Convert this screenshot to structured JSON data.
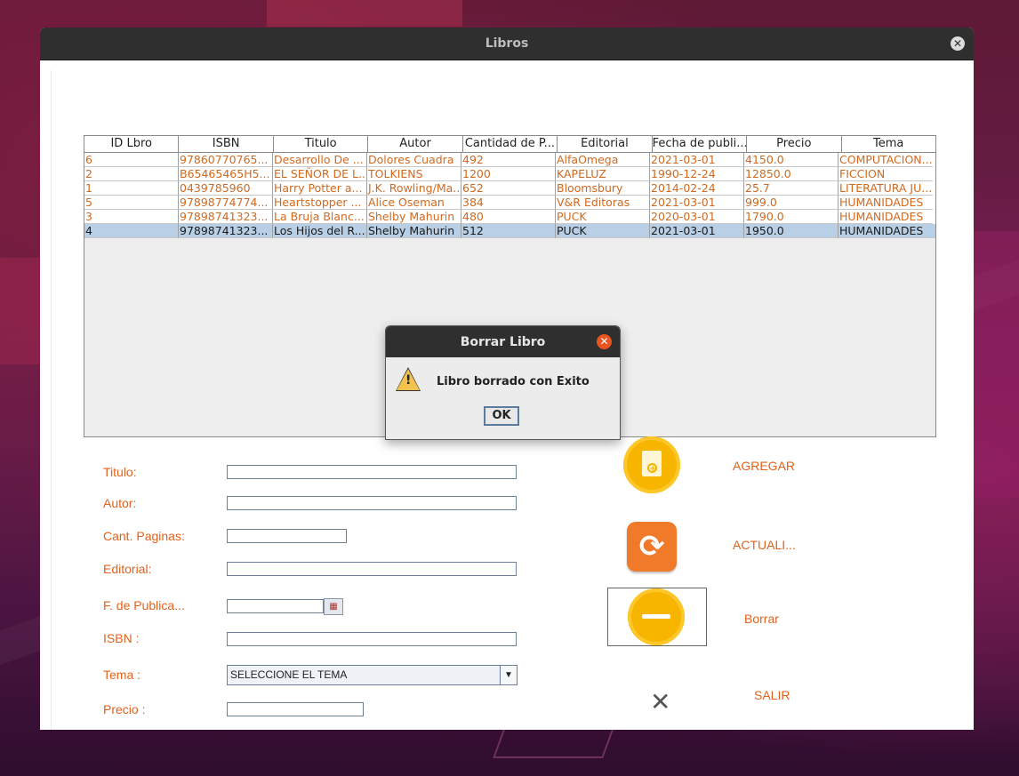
{
  "window": {
    "title": "Libros"
  },
  "table": {
    "headers": [
      "ID Lbro",
      "ISBN",
      "Titulo",
      "Autor",
      "Cantidad de P...",
      "Editorial",
      "Fecha de publi...",
      "Precio",
      "Tema"
    ],
    "rows": [
      [
        "6",
        "97860770765...",
        "Desarrollo De ...",
        "Dolores Cuadra",
        "492",
        "AlfaOmega",
        "2021-03-01",
        "4150.0",
        "COMPUTACION..."
      ],
      [
        "2",
        "B65465465H5...",
        "EL SEÑOR DE L...",
        "TOLKIENS",
        "1200",
        "KAPELUZ",
        "1990-12-24",
        "12850.0",
        "FICCION"
      ],
      [
        "1",
        "0439785960",
        "Harry Potter a...",
        "J.K. Rowling/Ma...",
        "652",
        "Bloomsbury",
        "2014-02-24",
        "25.7",
        "LITERATURA JU..."
      ],
      [
        "5",
        "97898774774...",
        "Heartstopper ...",
        "Alice Oseman",
        "384",
        "V&R Editoras",
        "2021-03-01",
        "999.0",
        "HUMANIDADES"
      ],
      [
        "3",
        "97898741323...",
        "La Bruja Blanc...",
        "Shelby Mahurin",
        "480",
        "PUCK",
        "2020-03-01",
        "1790.0",
        "HUMANIDADES"
      ],
      [
        "4",
        "97898741323...",
        "Los Hijos del R...",
        "Shelby Mahurin",
        "512",
        "PUCK",
        "2021-03-01",
        "1950.0",
        "HUMANIDADES"
      ]
    ],
    "selected_row": 5
  },
  "form": {
    "titulo_label": "Titulo:",
    "autor_label": "Autor:",
    "cant_label": "Cant. Paginas:",
    "editorial_label": "Editorial:",
    "fecha_label": "F. de Publica...",
    "isbn_label": "ISBN :",
    "tema_label": "Tema :",
    "precio_label": "Precio :",
    "tema_selected": "SELECCIONE EL TEMA"
  },
  "actions": {
    "agregar": "AGREGAR",
    "actualizar": "ACTUALI...",
    "borrar": "Borrar",
    "salir": "SALIR"
  },
  "dialog": {
    "title": "Borrar Libro",
    "message": "Libro borrado con Exito",
    "ok": "OK"
  },
  "colors": {
    "accent": "#e2621b",
    "icon_yellow": "#f7b500",
    "refresh_orange": "#f07a2a",
    "selection": "#b8cfe5"
  }
}
